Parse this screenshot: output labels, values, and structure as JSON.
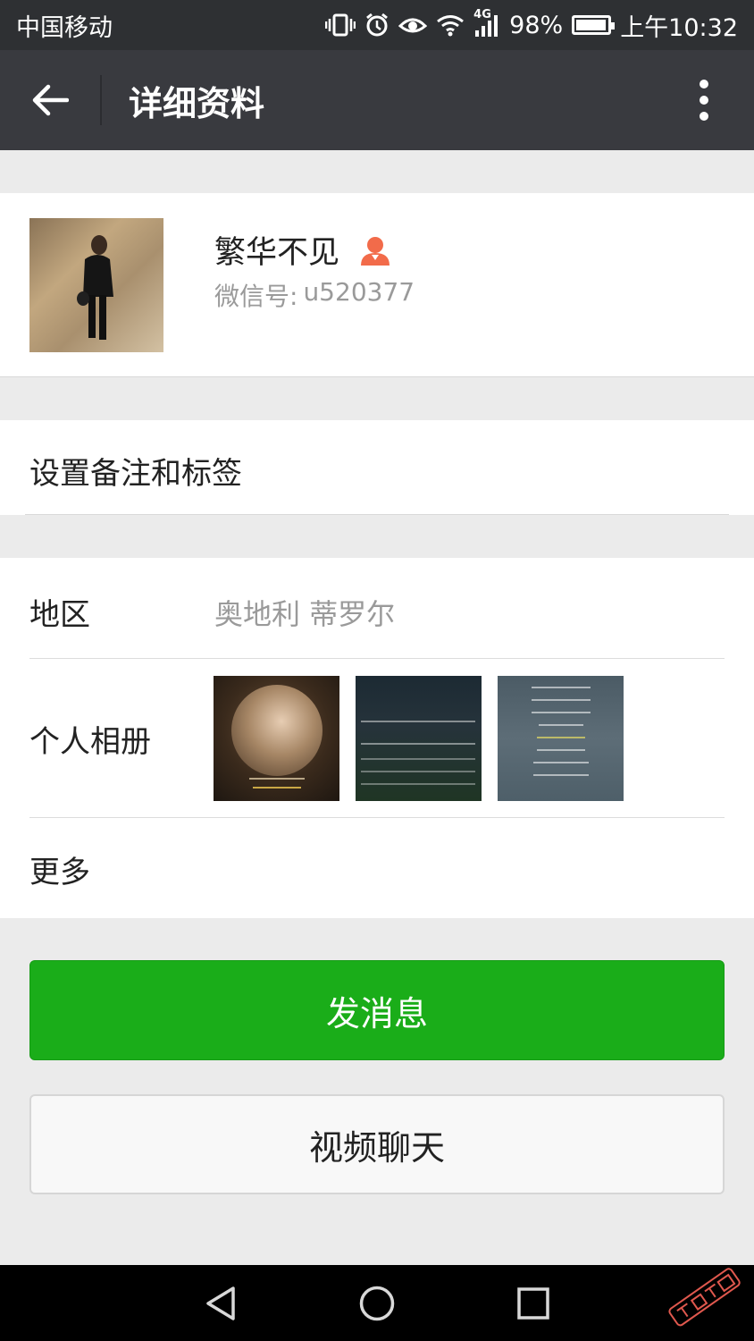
{
  "status_bar": {
    "carrier": "中国移动",
    "network": "4G",
    "battery": "98%",
    "battery_level": 0.98,
    "time": "上午10:32"
  },
  "header": {
    "title": "详细资料"
  },
  "profile": {
    "nickname": "繁华不见",
    "wechat_id_label": "微信号:",
    "wechat_id": "u520377"
  },
  "remark": {
    "label": "设置备注和标签"
  },
  "details": {
    "region_label": "地区",
    "region_value": "奥地利  蒂罗尔",
    "album_label": "个人相册",
    "more_label": "更多"
  },
  "actions": {
    "send_message": "发消息",
    "video_chat": "视频聊天"
  },
  "colors": {
    "status_bar_bg": "#2e3033",
    "title_bar_bg": "#393a3f",
    "primary_green": "#1aad19",
    "page_bg": "#ebebeb",
    "gender_icon": "#f26b4a"
  },
  "icons": {
    "back": "arrow-left-icon",
    "more": "more-vertical-icon",
    "gender": "female-user-icon",
    "nav_back": "triangle-back-icon",
    "nav_home": "circle-home-icon",
    "nav_recent": "square-recent-icon"
  }
}
